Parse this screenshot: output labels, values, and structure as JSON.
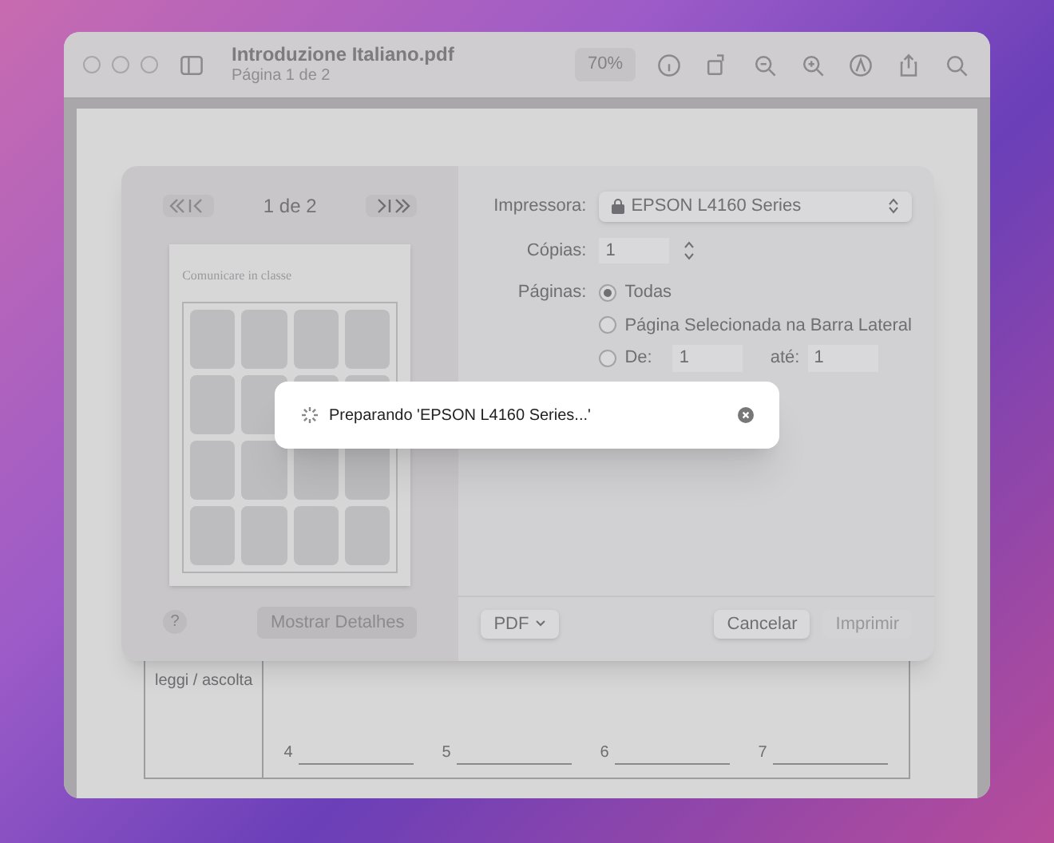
{
  "window": {
    "title": "Introduzione Italiano.pdf",
    "subtitle": "Página 1 de 2",
    "zoom": "70%"
  },
  "document": {
    "row_label": "leggi / ascolta",
    "blanks": [
      "4",
      "5",
      "6",
      "7"
    ]
  },
  "print_sheet": {
    "page_counter": "1 de 2",
    "thumbnail_title": "Comunicare in classe",
    "printer_label": "Impressora:",
    "printer": "EPSON L4160 Series",
    "copies_label": "Cópias:",
    "copies": "1",
    "pages_label": "Páginas:",
    "page_options": [
      {
        "label": "Todas",
        "selected": true,
        "kind": "plain"
      },
      {
        "label": "Página Selecionada na Barra Lateral",
        "selected": false,
        "kind": "plain"
      },
      {
        "label": "De:",
        "selected": false,
        "kind": "range",
        "from": "1",
        "to_label": "até:",
        "to": "1"
      }
    ],
    "help": "?",
    "details_button": "Mostrar Detalhes",
    "pdf_button": "PDF",
    "cancel_button": "Cancelar",
    "print_button": {
      "label": "Imprimir",
      "disabled": true
    }
  },
  "toast": {
    "message": "Preparando 'EPSON L4160 Series...'"
  }
}
